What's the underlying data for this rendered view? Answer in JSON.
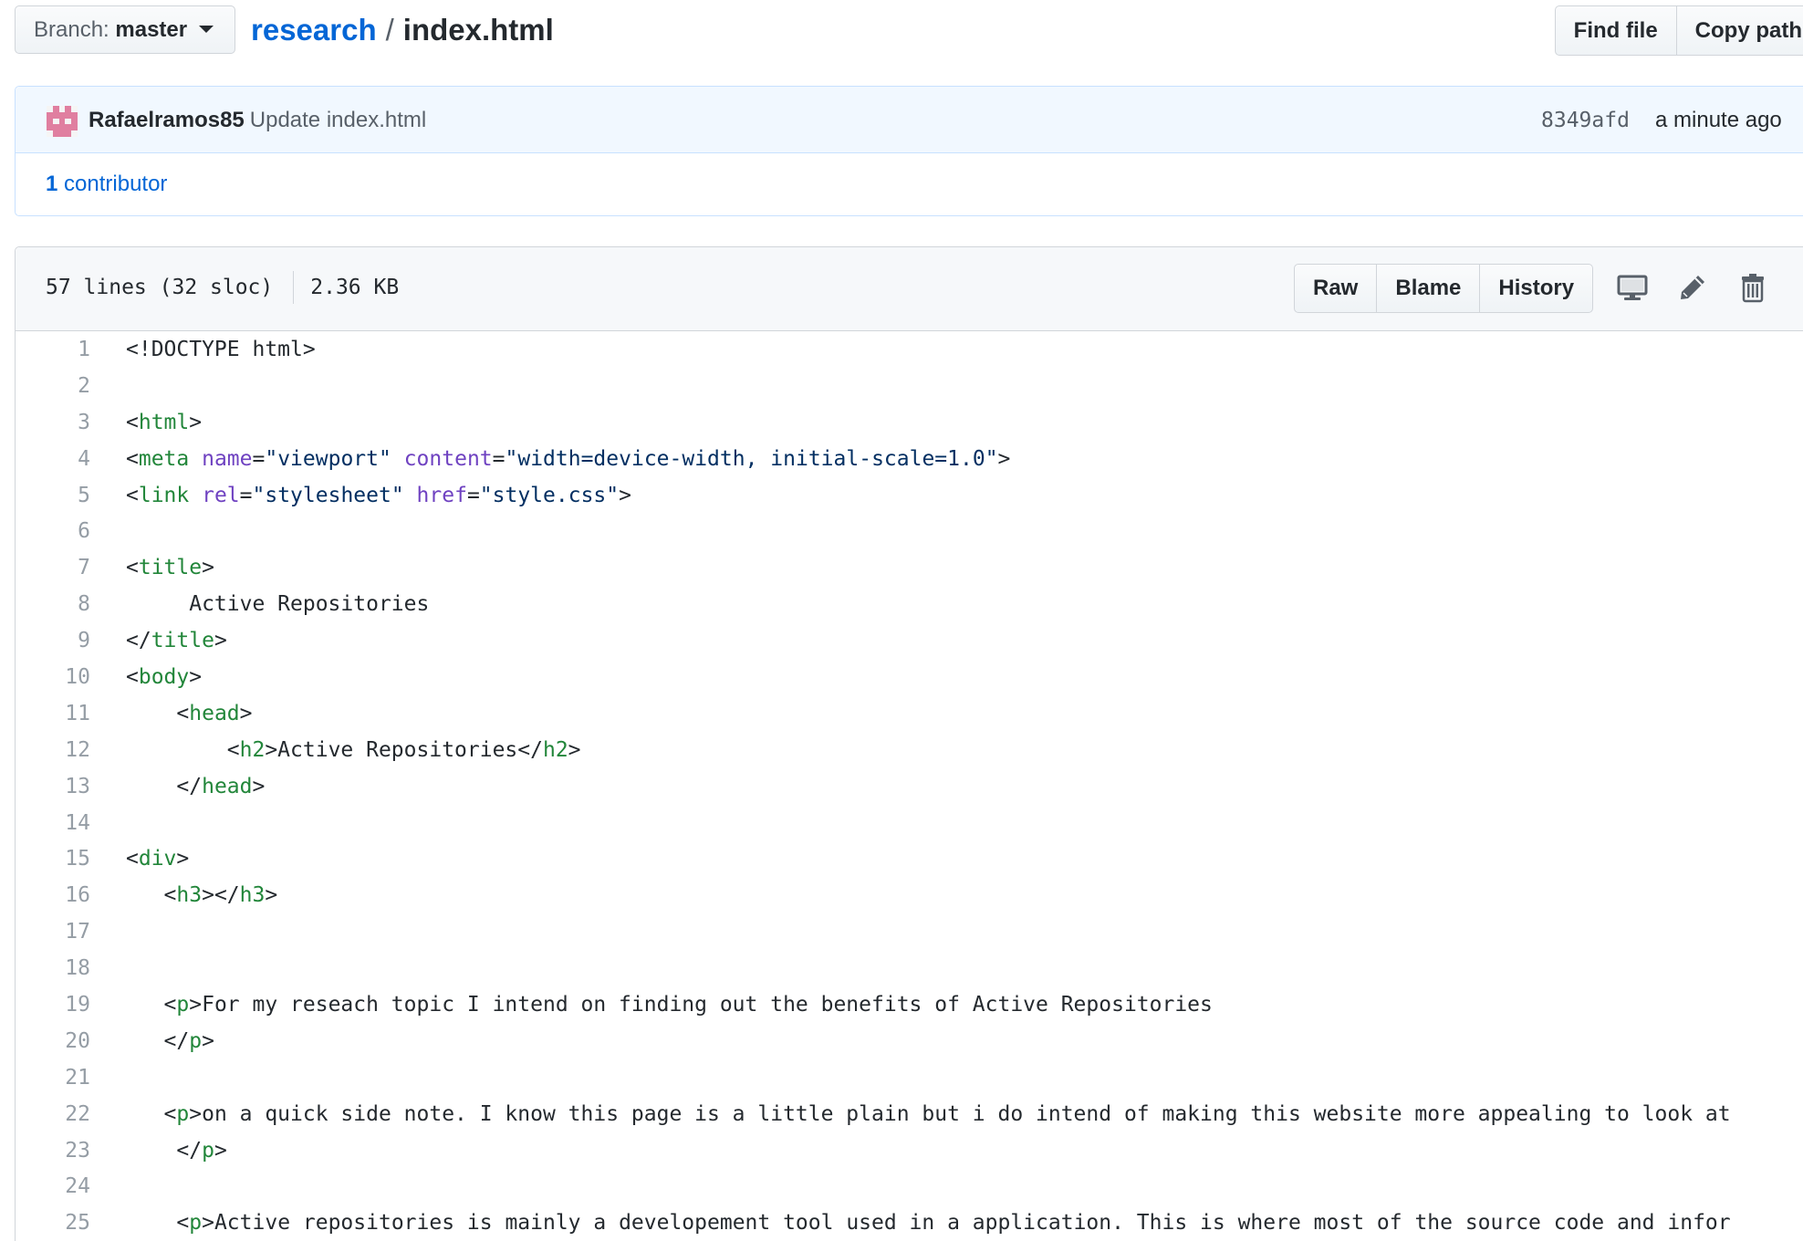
{
  "topbar": {
    "branch_label": "Branch:",
    "branch_value": "master",
    "repo_name": "research",
    "separator": "/",
    "file_name": "index.html",
    "find_file": "Find file",
    "copy_path": "Copy path"
  },
  "commit": {
    "author": "Rafaelramos85",
    "message": "Update index.html",
    "sha": "8349afd",
    "time": "a minute ago",
    "contributors_count": "1",
    "contributors_label": "contributor"
  },
  "file": {
    "lines_info": "57 lines (32 sloc)",
    "size": "2.36 KB",
    "raw": "Raw",
    "blame": "Blame",
    "history": "History",
    "icons": [
      "desktop-icon",
      "pencil-icon",
      "trash-icon"
    ]
  },
  "colors": {
    "link": "#0366d6",
    "tag": "#22863a",
    "attribute": "#6f42c1",
    "string": "#032f62",
    "line_number": "#959da5"
  },
  "code_lines": [
    {
      "n": "1",
      "tokens": [
        [
          "p",
          "<!DOCTYPE html>"
        ]
      ]
    },
    {
      "n": "2",
      "tokens": []
    },
    {
      "n": "3",
      "tokens": [
        [
          "p",
          "<"
        ],
        [
          "t",
          "html"
        ],
        [
          "p",
          ">"
        ]
      ]
    },
    {
      "n": "4",
      "tokens": [
        [
          "p",
          "<"
        ],
        [
          "t",
          "meta"
        ],
        [
          "p",
          " "
        ],
        [
          "a",
          "name"
        ],
        [
          "p",
          "="
        ],
        [
          "s",
          "\"viewport\""
        ],
        [
          "p",
          " "
        ],
        [
          "a",
          "content"
        ],
        [
          "p",
          "="
        ],
        [
          "s",
          "\"width=device-width, initial-scale=1.0\""
        ],
        [
          "p",
          ">"
        ]
      ]
    },
    {
      "n": "5",
      "tokens": [
        [
          "p",
          "<"
        ],
        [
          "t",
          "link"
        ],
        [
          "p",
          " "
        ],
        [
          "a",
          "rel"
        ],
        [
          "p",
          "="
        ],
        [
          "s",
          "\"stylesheet\""
        ],
        [
          "p",
          " "
        ],
        [
          "a",
          "href"
        ],
        [
          "p",
          "="
        ],
        [
          "s",
          "\"style.css\""
        ],
        [
          "p",
          ">"
        ]
      ]
    },
    {
      "n": "6",
      "tokens": []
    },
    {
      "n": "7",
      "tokens": [
        [
          "p",
          "<"
        ],
        [
          "t",
          "title"
        ],
        [
          "p",
          ">"
        ]
      ]
    },
    {
      "n": "8",
      "tokens": [
        [
          "p",
          "     Active Repositories"
        ]
      ]
    },
    {
      "n": "9",
      "tokens": [
        [
          "p",
          "</"
        ],
        [
          "t",
          "title"
        ],
        [
          "p",
          ">"
        ]
      ]
    },
    {
      "n": "10",
      "tokens": [
        [
          "p",
          "<"
        ],
        [
          "t",
          "body"
        ],
        [
          "p",
          ">"
        ]
      ]
    },
    {
      "n": "11",
      "tokens": [
        [
          "p",
          "    <"
        ],
        [
          "t",
          "head"
        ],
        [
          "p",
          ">"
        ]
      ]
    },
    {
      "n": "12",
      "tokens": [
        [
          "p",
          "        <"
        ],
        [
          "t",
          "h2"
        ],
        [
          "p",
          ">Active Repositories</"
        ],
        [
          "t",
          "h2"
        ],
        [
          "p",
          ">"
        ]
      ]
    },
    {
      "n": "13",
      "tokens": [
        [
          "p",
          "    </"
        ],
        [
          "t",
          "head"
        ],
        [
          "p",
          ">"
        ]
      ]
    },
    {
      "n": "14",
      "tokens": []
    },
    {
      "n": "15",
      "tokens": [
        [
          "p",
          "<"
        ],
        [
          "t",
          "div"
        ],
        [
          "p",
          ">"
        ]
      ]
    },
    {
      "n": "16",
      "tokens": [
        [
          "p",
          "   <"
        ],
        [
          "t",
          "h3"
        ],
        [
          "p",
          "></"
        ],
        [
          "t",
          "h3"
        ],
        [
          "p",
          ">"
        ]
      ]
    },
    {
      "n": "17",
      "tokens": []
    },
    {
      "n": "18",
      "tokens": []
    },
    {
      "n": "19",
      "tokens": [
        [
          "p",
          "   <"
        ],
        [
          "t",
          "p"
        ],
        [
          "p",
          ">For my reseach topic I intend on finding out the benefits of Active Repositories"
        ]
      ]
    },
    {
      "n": "20",
      "tokens": [
        [
          "p",
          "   </"
        ],
        [
          "t",
          "p"
        ],
        [
          "p",
          ">"
        ]
      ]
    },
    {
      "n": "21",
      "tokens": []
    },
    {
      "n": "22",
      "tokens": [
        [
          "p",
          "   <"
        ],
        [
          "t",
          "p"
        ],
        [
          "p",
          ">on a quick side note. I know this page is a little plain but i do intend of making this website more appealing to look at"
        ]
      ]
    },
    {
      "n": "23",
      "tokens": [
        [
          "p",
          "    </"
        ],
        [
          "t",
          "p"
        ],
        [
          "p",
          ">"
        ]
      ]
    },
    {
      "n": "24",
      "tokens": []
    },
    {
      "n": "25",
      "tokens": [
        [
          "p",
          "    <"
        ],
        [
          "t",
          "p"
        ],
        [
          "p",
          ">Active repositories is mainly a developement tool used in a application. This is where most of the source code and infor"
        ]
      ]
    }
  ]
}
